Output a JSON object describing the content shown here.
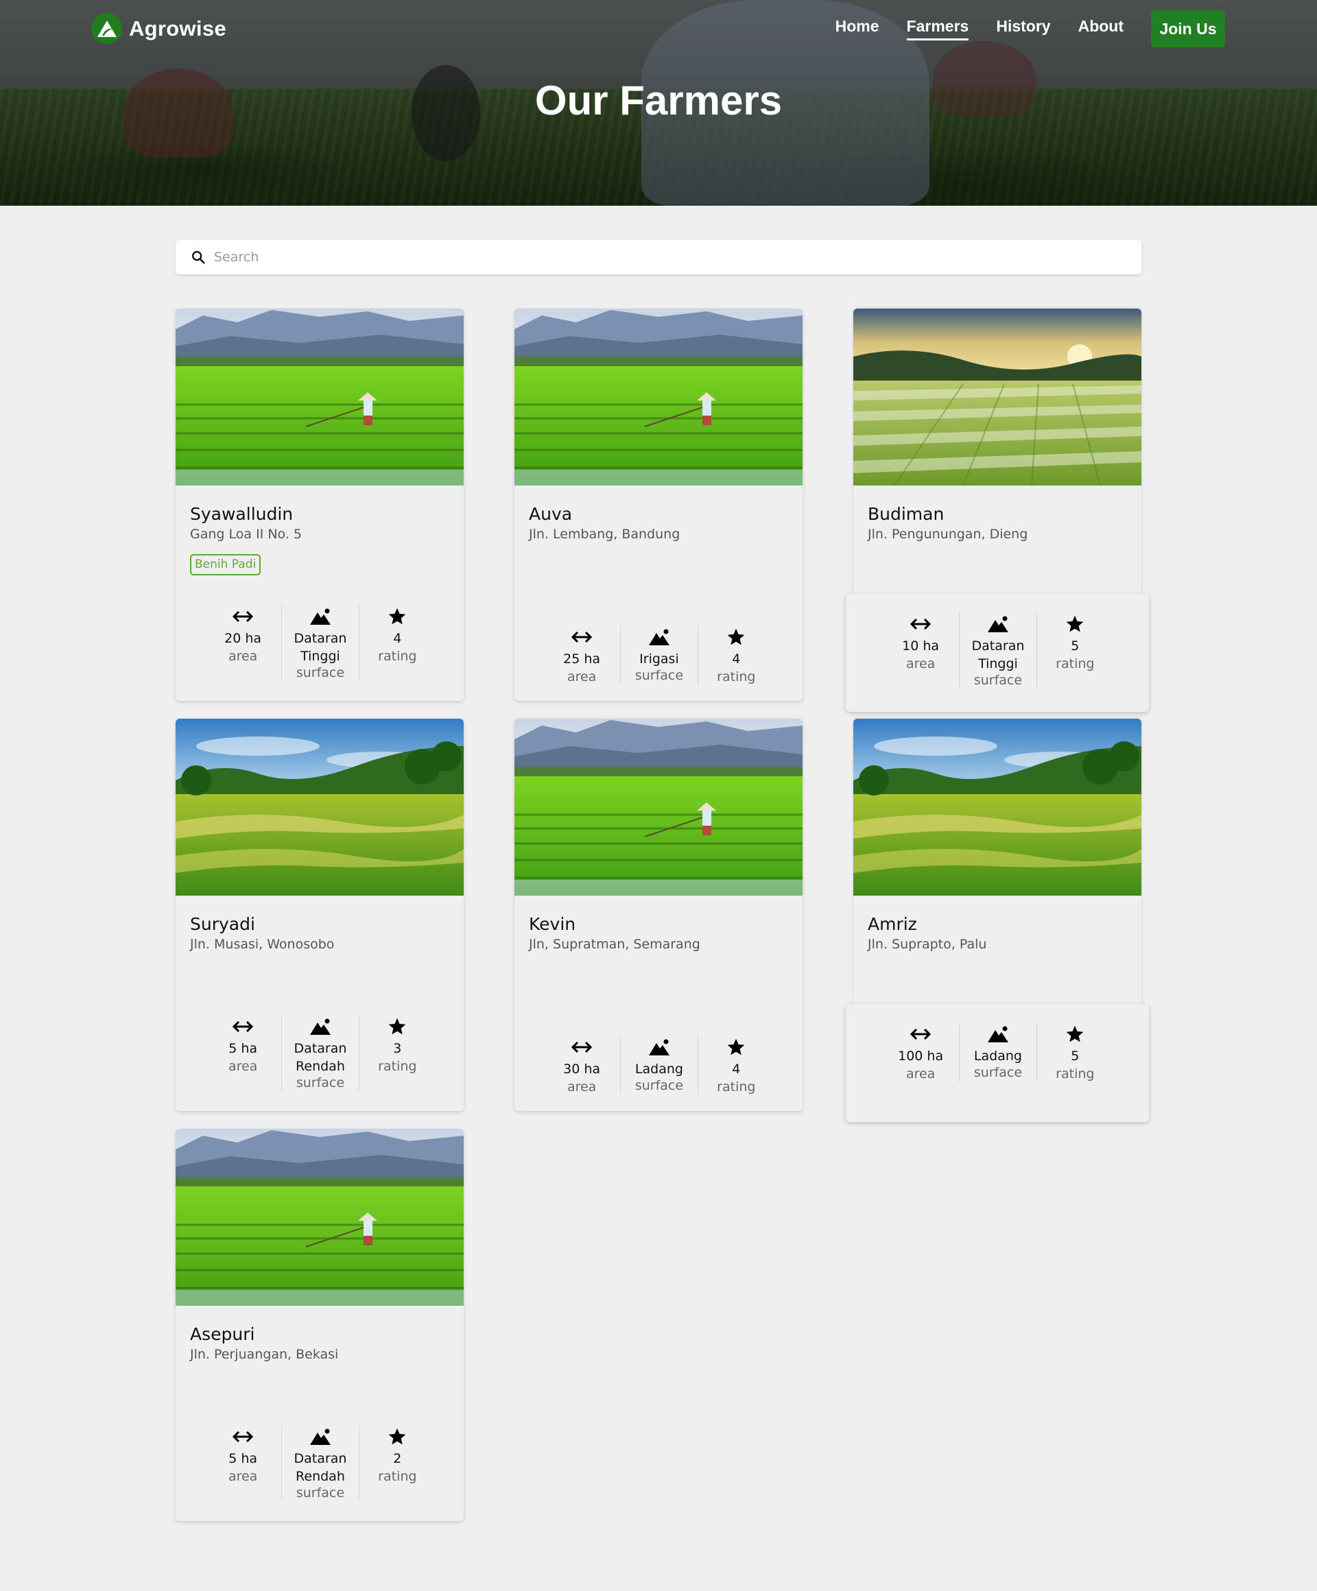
{
  "nav": {
    "brand": "Agrowise",
    "links": [
      "Home",
      "Farmers",
      "History",
      "About"
    ],
    "active": "Farmers",
    "cta": "Join Us"
  },
  "hero": {
    "title": "Our Farmers"
  },
  "search": {
    "placeholder": "Search",
    "value": ""
  },
  "farmers": [
    {
      "name": "Syawalludin",
      "address": "Gang Loa II No. 5",
      "badge": "Benih Padi",
      "area": "20 ha",
      "surface": "Dataran Tinggi",
      "rating": "4"
    },
    {
      "name": "Auva",
      "address": "Jln. Lembang, Bandung",
      "area": "25 ha",
      "surface": "Irigasi",
      "rating": "4"
    },
    {
      "name": "Budiman",
      "address": "Jln. Pengunungan, Dieng",
      "area": "10 ha",
      "surface": "Dataran Tinggi",
      "rating": "5"
    },
    {
      "name": "Suryadi",
      "address": "Jln. Musasi, Wonosobo",
      "area": "5 ha",
      "surface": "Dataran Rendah",
      "rating": "3"
    },
    {
      "name": "Kevin",
      "address": "Jln, Supratman, Semarang",
      "area": "30 ha",
      "surface": "Ladang",
      "rating": "4"
    },
    {
      "name": "Amriz",
      "address": "Jln. Suprapto, Palu",
      "area": "100 ha",
      "surface": "Ladang",
      "rating": "5"
    },
    {
      "name": "Asepuri",
      "address": "Jln. Perjuangan, Bekasi",
      "area": "5 ha",
      "surface": "Dataran Rendah",
      "rating": "2"
    }
  ],
  "stat_labels": {
    "area": "area",
    "surface": "surface",
    "rating": "rating"
  },
  "icons": {
    "area": "arrows-left-right-icon",
    "surface": "mountain-sun-icon",
    "rating": "star-icon",
    "search": "search-icon"
  },
  "colors": {
    "brand": "#218023",
    "badge": "#5ea83a",
    "background": "#efefef"
  }
}
